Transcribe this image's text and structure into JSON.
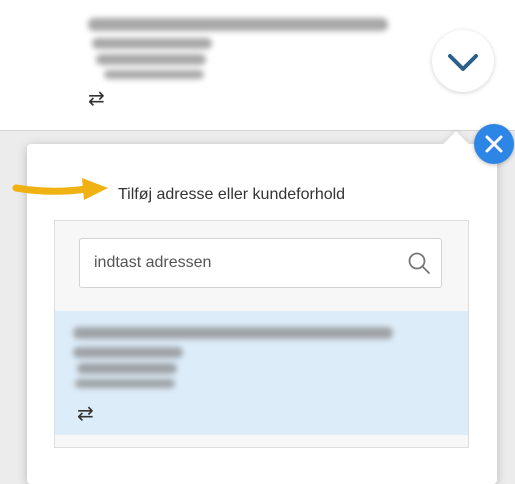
{
  "current_account": {
    "address_obscured": true,
    "swap_icon": "swap-horizontal-icon",
    "swap_glyph": "⇄"
  },
  "expand_button": {
    "icon": "chevron-down-icon"
  },
  "popover": {
    "close_icon": "close-icon",
    "add_label": "Tilføj adresse eller kundeforhold",
    "search": {
      "placeholder": "indtast adressen",
      "value": "",
      "icon": "search-icon"
    },
    "accounts": [
      {
        "address_obscured": true,
        "selected": true,
        "swap_glyph": "⇄"
      }
    ]
  },
  "annotation": {
    "icon": "arrow-right-icon",
    "color": "#f0b113"
  },
  "colors": {
    "accent": "#2d86e6",
    "selected_row": "#dcecf9",
    "chevron": "#2b5f8a"
  }
}
